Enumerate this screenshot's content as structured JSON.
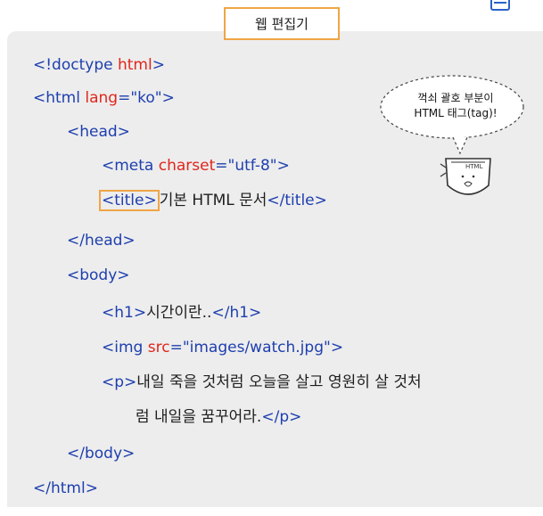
{
  "editor": {
    "title": "웹 편집기"
  },
  "bubble": {
    "line1": "꺽쇠 괄호 부분이",
    "line2": "HTML 태그(tag)!",
    "shield_label": "HTML"
  },
  "code": {
    "l1_tag_open": "<!doctype ",
    "l1_word": "html",
    "l1_tag_close": ">",
    "l2_open": "<html ",
    "l2_attr": "lang",
    "l2_eq": "=",
    "l2_val": "\"ko\"",
    "l2_close": ">",
    "l3": "<head>",
    "l4_open": "<meta ",
    "l4_attr": "charset",
    "l4_eq": "=",
    "l4_val": "\"utf-8\"",
    "l4_close": ">",
    "l5_open": "<title>",
    "l5_text": "기본 HTML 문서",
    "l5_close": "</title>",
    "l6": "</head>",
    "l7": "<body>",
    "l8_open": "<h1>",
    "l8_text": "시간이란..",
    "l8_close": "</h1>",
    "l9_open": "<img ",
    "l9_attr": "src",
    "l9_eq": "=",
    "l9_val": "\"images/watch.jpg\"",
    "l9_close": ">",
    "l10_open": "<p>",
    "l10_text": "내일 죽을 것처럼 오늘을 살고 영원히 살 것처",
    "l11_text": "럼 내일을 꿈꾸어라.",
    "l11_close": "</p>",
    "l12": "</body>",
    "l13": "</html>"
  }
}
